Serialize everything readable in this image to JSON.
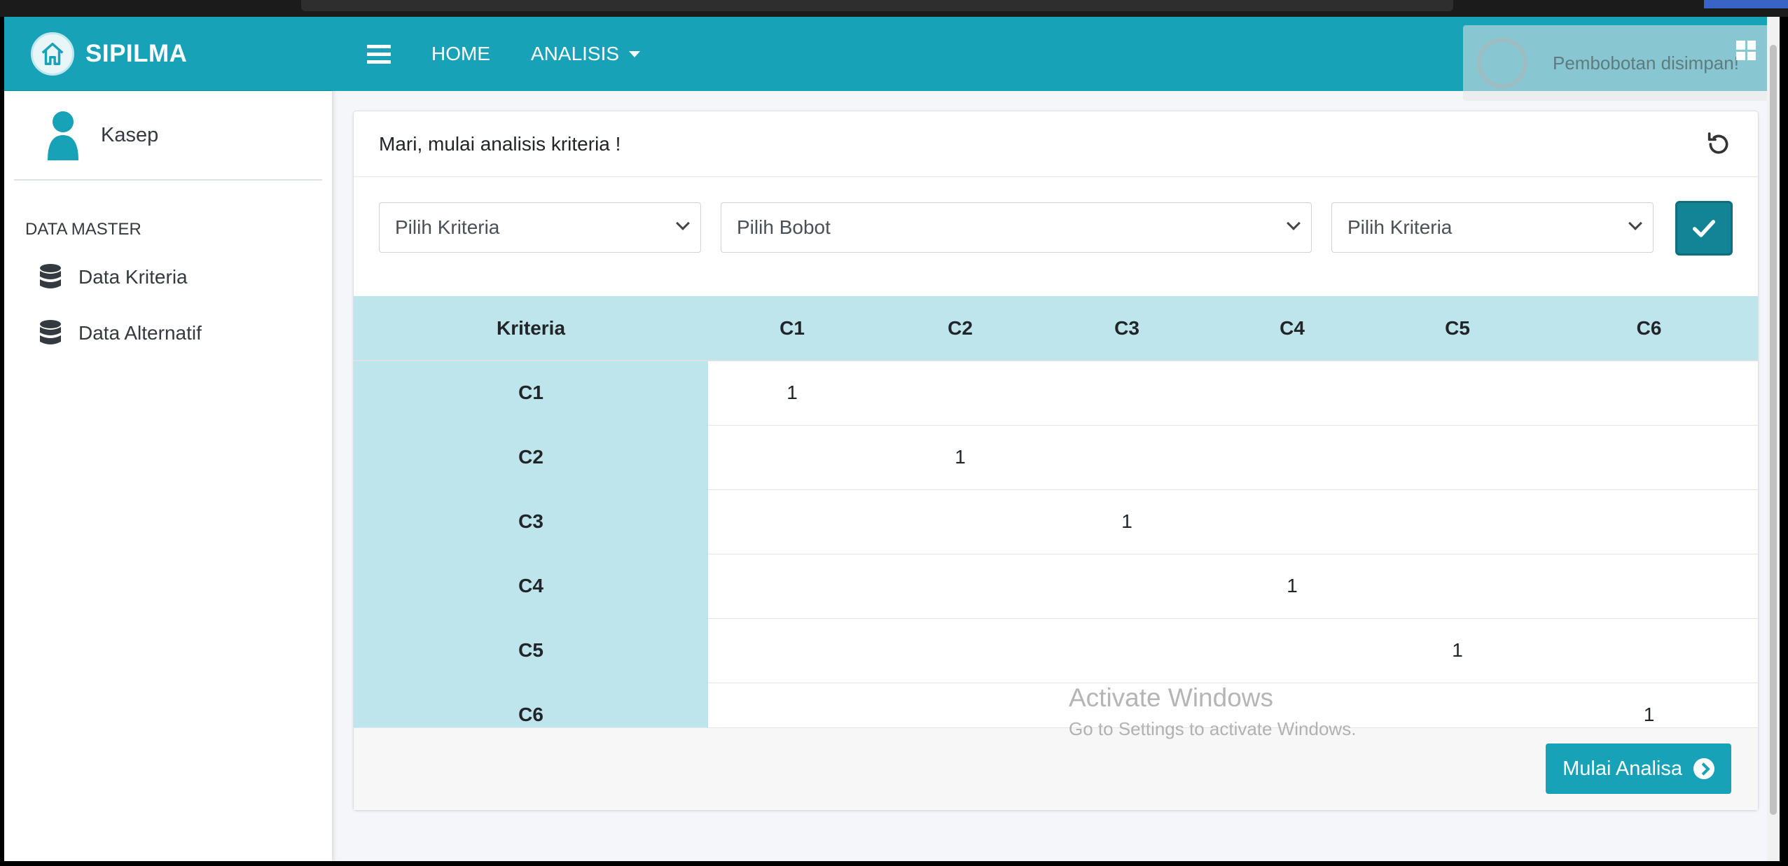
{
  "brand": {
    "name": "SIPILMA"
  },
  "user": {
    "name": "Kasep"
  },
  "sidebar": {
    "header": "DATA MASTER",
    "items": [
      {
        "label": "Data Kriteria",
        "icon": "database-icon"
      },
      {
        "label": "Data Alternatif",
        "icon": "database-icon"
      }
    ]
  },
  "topnav": {
    "home": "HOME",
    "analisis": "ANALISIS"
  },
  "toast": {
    "message": "Pembobotan disimpan!"
  },
  "card": {
    "title": "Mari, mulai analisis kriteria !",
    "select_left": "Pilih Kriteria",
    "select_middle": "Pilih Bobot",
    "select_right": "Pilih Kriteria",
    "start_button": "Mulai Analisa"
  },
  "table": {
    "headers": [
      "Kriteria",
      "C1",
      "C2",
      "C3",
      "C4",
      "C5",
      "C6"
    ],
    "rows": [
      {
        "label": "C1",
        "cells": [
          "1",
          "",
          "",
          "",
          "",
          ""
        ]
      },
      {
        "label": "C2",
        "cells": [
          "",
          "1",
          "",
          "",
          "",
          ""
        ]
      },
      {
        "label": "C3",
        "cells": [
          "",
          "",
          "1",
          "",
          "",
          ""
        ]
      },
      {
        "label": "C4",
        "cells": [
          "",
          "",
          "",
          "1",
          "",
          ""
        ]
      },
      {
        "label": "C5",
        "cells": [
          "",
          "",
          "",
          "",
          "1",
          ""
        ]
      },
      {
        "label": "C6",
        "cells": [
          "",
          "",
          "",
          "",
          "",
          "1"
        ]
      }
    ]
  },
  "watermark": {
    "line1": "Activate Windows",
    "line2": "Go to Settings to activate Windows."
  },
  "colors": {
    "primary": "#17a2b8",
    "table_header": "#bee5eb",
    "button_dark": "#138496"
  }
}
